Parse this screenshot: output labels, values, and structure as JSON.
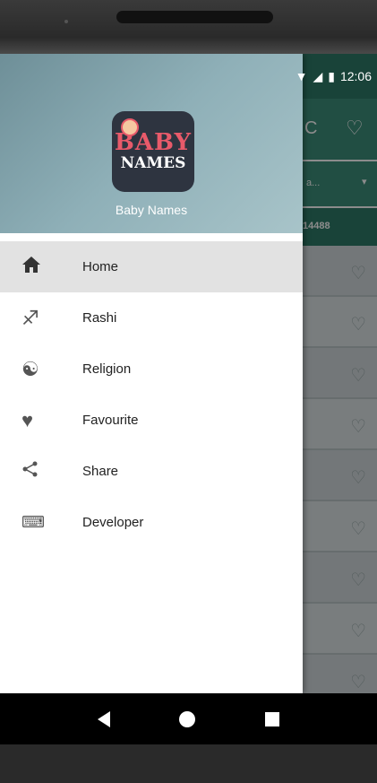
{
  "status": {
    "time": "12:06"
  },
  "background": {
    "spinner_text": "a...",
    "count_text": "14488"
  },
  "drawer": {
    "logo_top": "BABY",
    "logo_bottom": "NAMES",
    "app_name": "Baby Names",
    "items": [
      {
        "label": "Home",
        "icon": "home-icon",
        "active": true
      },
      {
        "label": "Rashi",
        "icon": "rashi-icon"
      },
      {
        "label": "Religion",
        "icon": "religion-icon"
      },
      {
        "label": "Favourite",
        "icon": "heart-icon"
      },
      {
        "label": "Share",
        "icon": "share-icon"
      },
      {
        "label": "Developer",
        "icon": "developer-icon"
      }
    ]
  },
  "colors": {
    "primary": "#3d8e7b",
    "primary_dark": "#2f7a69",
    "active_item": "#e2e2e2"
  }
}
